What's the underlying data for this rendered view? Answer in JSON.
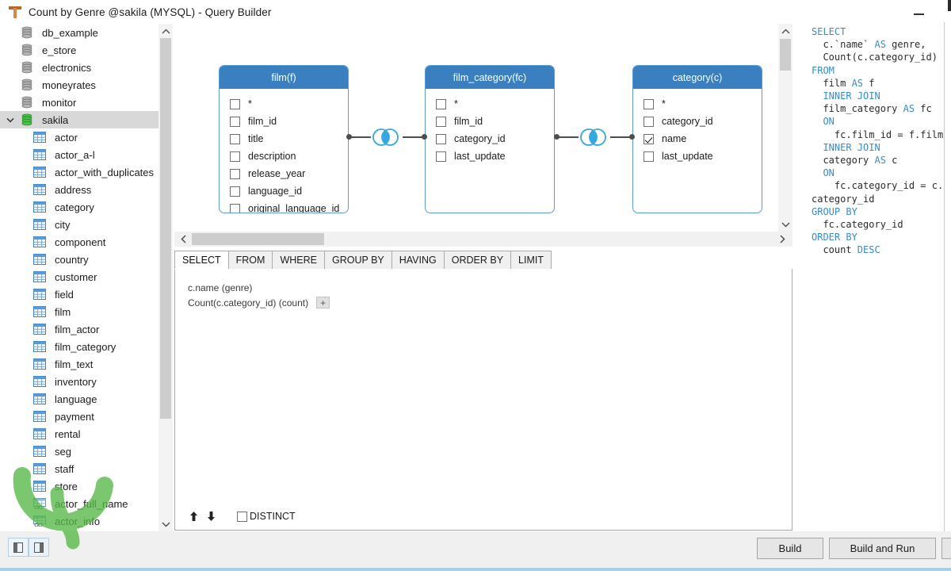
{
  "window": {
    "title": "Count by Genre @sakila (MYSQL) - Query Builder",
    "app_icon": "query-builder-icon",
    "minimize_label": "—"
  },
  "tree": {
    "databases": [
      {
        "label": "db_example",
        "icon": "database-icon",
        "selected": false,
        "expanded": false
      },
      {
        "label": "e_store",
        "icon": "database-icon",
        "selected": false,
        "expanded": false
      },
      {
        "label": "electronics",
        "icon": "database-icon",
        "selected": false,
        "expanded": false
      },
      {
        "label": "moneyrates",
        "icon": "database-icon",
        "selected": false,
        "expanded": false
      },
      {
        "label": "monitor",
        "icon": "database-icon",
        "selected": false,
        "expanded": false
      },
      {
        "label": "sakila",
        "icon": "database-icon-active",
        "selected": true,
        "expanded": true
      }
    ],
    "tables": [
      {
        "label": "actor",
        "icon": "table-icon"
      },
      {
        "label": "actor_a-l",
        "icon": "table-icon"
      },
      {
        "label": "actor_with_duplicates",
        "icon": "table-icon"
      },
      {
        "label": "address",
        "icon": "table-icon"
      },
      {
        "label": "category",
        "icon": "table-icon"
      },
      {
        "label": "city",
        "icon": "table-icon"
      },
      {
        "label": "component",
        "icon": "table-icon"
      },
      {
        "label": "country",
        "icon": "table-icon"
      },
      {
        "label": "customer",
        "icon": "table-icon"
      },
      {
        "label": "field",
        "icon": "table-icon"
      },
      {
        "label": "film",
        "icon": "table-icon"
      },
      {
        "label": "film_actor",
        "icon": "table-icon"
      },
      {
        "label": "film_category",
        "icon": "table-icon"
      },
      {
        "label": "film_text",
        "icon": "table-icon"
      },
      {
        "label": "inventory",
        "icon": "table-icon"
      },
      {
        "label": "language",
        "icon": "table-icon"
      },
      {
        "label": "payment",
        "icon": "table-icon"
      },
      {
        "label": "rental",
        "icon": "table-icon"
      },
      {
        "label": "seg",
        "icon": "table-icon"
      },
      {
        "label": "staff",
        "icon": "table-icon"
      },
      {
        "label": "store",
        "icon": "table-icon"
      },
      {
        "label": "actor_full_name",
        "icon": "view-icon"
      },
      {
        "label": "actor_info",
        "icon": "view-icon"
      }
    ],
    "scrollbar": {
      "up": "chevron-up-icon",
      "down": "chevron-down-icon"
    }
  },
  "diagram": {
    "tables": [
      {
        "title": "film(f)",
        "fields": [
          {
            "name": "*",
            "checked": false
          },
          {
            "name": "film_id",
            "checked": false
          },
          {
            "name": "title",
            "checked": false
          },
          {
            "name": "description",
            "checked": false
          },
          {
            "name": "release_year",
            "checked": false
          },
          {
            "name": "language_id",
            "checked": false
          },
          {
            "name": "original_language_id",
            "checked": false
          }
        ]
      },
      {
        "title": "film_category(fc)",
        "fields": [
          {
            "name": "*",
            "checked": false
          },
          {
            "name": "film_id",
            "checked": false
          },
          {
            "name": "category_id",
            "checked": false
          },
          {
            "name": "last_update",
            "checked": false
          }
        ]
      },
      {
        "title": "category(c)",
        "fields": [
          {
            "name": "*",
            "checked": false
          },
          {
            "name": "category_id",
            "checked": false
          },
          {
            "name": "name",
            "checked": true
          },
          {
            "name": "last_update",
            "checked": false
          }
        ]
      }
    ],
    "joins": [
      {
        "type": "inner-join",
        "icon": "inner-join-venn-icon"
      },
      {
        "type": "inner-join",
        "icon": "inner-join-venn-icon"
      }
    ],
    "header_color": "#3a80c1",
    "border_color": "#5b9bd5",
    "hscroll": {
      "left": "chevron-left-icon",
      "right": "chevron-right-icon"
    },
    "vscroll": {
      "up": "chevron-up-icon",
      "down": "chevron-down-icon"
    }
  },
  "tabs": [
    {
      "label": "SELECT",
      "active": true
    },
    {
      "label": "FROM",
      "active": false
    },
    {
      "label": "WHERE",
      "active": false
    },
    {
      "label": "GROUP BY",
      "active": false
    },
    {
      "label": "HAVING",
      "active": false
    },
    {
      "label": "ORDER BY",
      "active": false
    },
    {
      "label": "LIMIT",
      "active": false
    }
  ],
  "select_pane": {
    "items": [
      {
        "expression": "c.name",
        "alias": "(genre)",
        "has_add": false
      },
      {
        "expression": "Count(c.category_id)",
        "alias": "(count)",
        "has_add": true
      }
    ],
    "add_label": "+",
    "move_up": "arrow-up-icon",
    "move_down": "arrow-down-icon",
    "distinct_label": "DISTINCT",
    "distinct_checked": false
  },
  "sql": {
    "lines": [
      [
        {
          "t": "SELECT",
          "k": true
        }
      ],
      [
        {
          "t": "  c.`name` ",
          "k": false
        },
        {
          "t": "AS",
          "k": true
        },
        {
          "t": " genre,",
          "k": false
        }
      ],
      [
        {
          "t": "  Count(c.category_id)",
          "k": false
        }
      ],
      [
        {
          "t": "FROM",
          "k": true
        }
      ],
      [
        {
          "t": "  film ",
          "k": false
        },
        {
          "t": "AS",
          "k": true
        },
        {
          "t": " f",
          "k": false
        }
      ],
      [
        {
          "t": "  ",
          "k": false
        },
        {
          "t": "INNER JOIN",
          "k": true
        }
      ],
      [
        {
          "t": "  film_category ",
          "k": false
        },
        {
          "t": "AS",
          "k": true
        },
        {
          "t": " fc",
          "k": false
        }
      ],
      [
        {
          "t": "  ",
          "k": false
        },
        {
          "t": "ON",
          "k": true
        }
      ],
      [
        {
          "t": "    fc.film_id = f.film",
          "k": false
        }
      ],
      [
        {
          "t": "  ",
          "k": false
        },
        {
          "t": "INNER JOIN",
          "k": true
        }
      ],
      [
        {
          "t": "  category ",
          "k": false
        },
        {
          "t": "AS",
          "k": true
        },
        {
          "t": " c",
          "k": false
        }
      ],
      [
        {
          "t": "  ",
          "k": false
        },
        {
          "t": "ON",
          "k": true
        }
      ],
      [
        {
          "t": "    fc.category_id = c.",
          "k": false
        }
      ],
      [
        {
          "t": "category_id",
          "k": false
        }
      ],
      [
        {
          "t": "GROUP BY",
          "k": true
        }
      ],
      [
        {
          "t": "  fc.category_id",
          "k": false
        }
      ],
      [
        {
          "t": "ORDER BY",
          "k": true
        }
      ],
      [
        {
          "t": "  count ",
          "k": false
        },
        {
          "t": "DESC",
          "k": true
        }
      ]
    ],
    "keyword_color": "#3b8bc4",
    "text_color": "#2b2b2b"
  },
  "bottom": {
    "build_label": "Build",
    "build_and_run_label": "Build and Run",
    "extra_label": "",
    "toggle_left": "panel-left-toggle-icon",
    "toggle_right": "panel-right-toggle-icon"
  }
}
